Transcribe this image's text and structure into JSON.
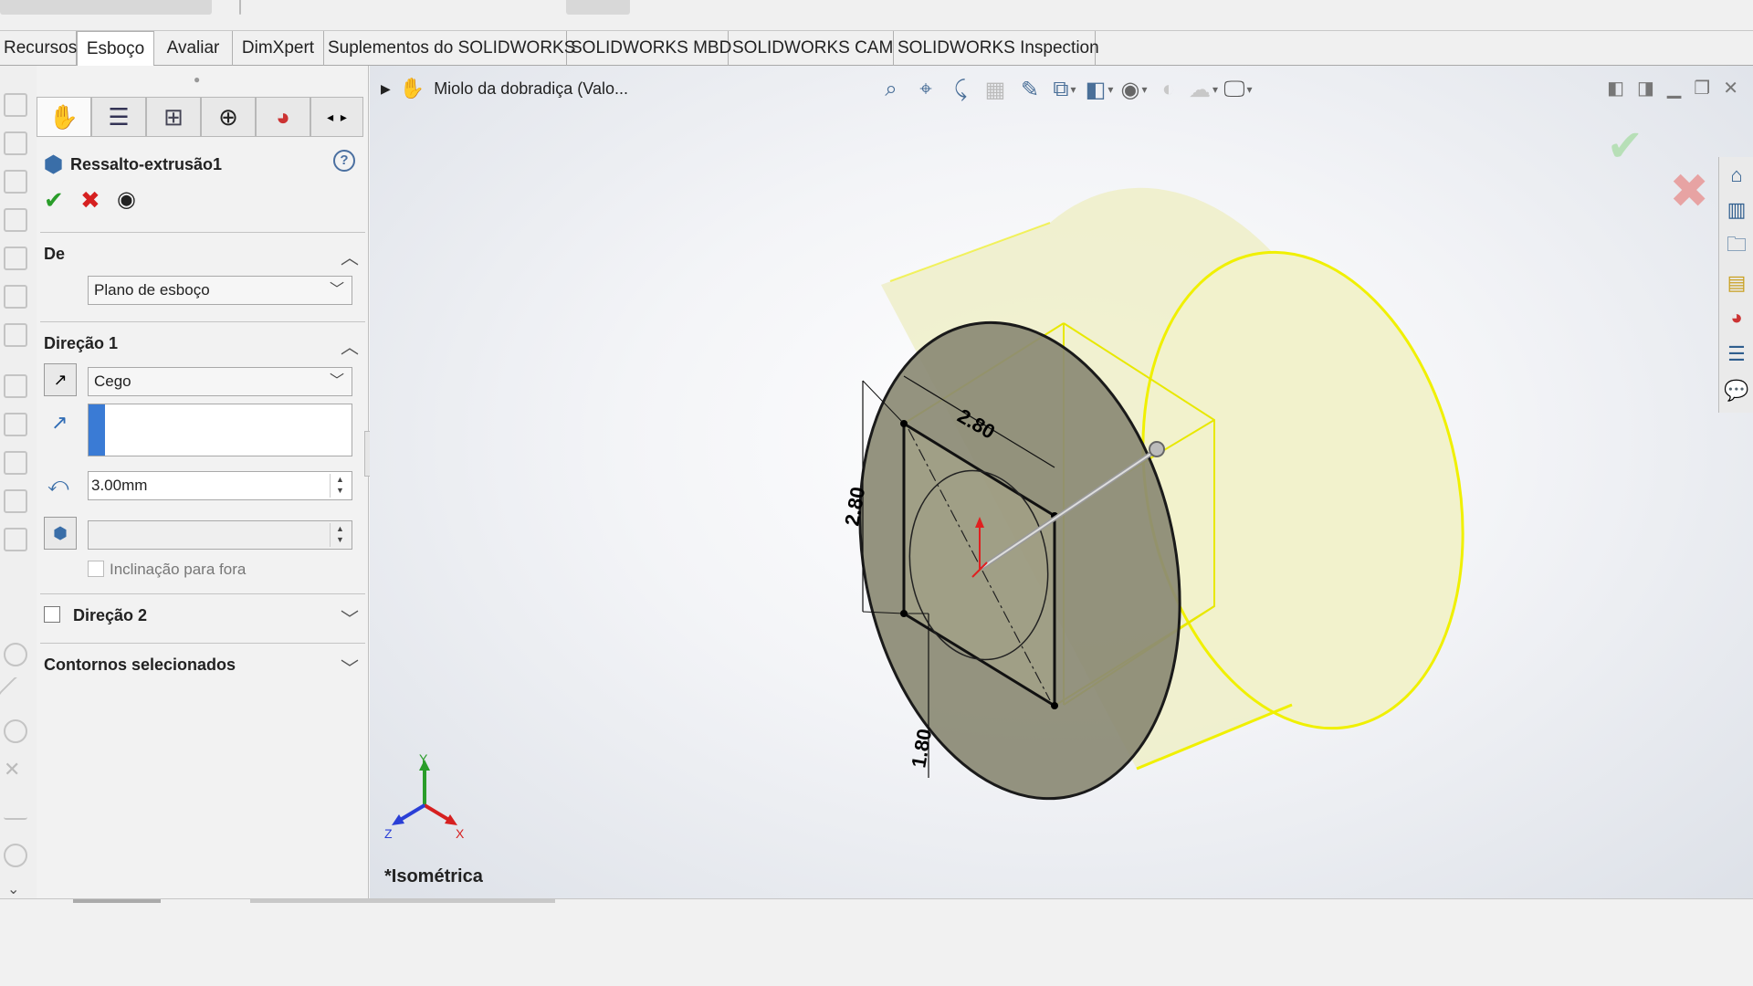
{
  "tabs": [
    {
      "label": "Recursos"
    },
    {
      "label": "Esboço"
    },
    {
      "label": "Avaliar"
    },
    {
      "label": "DimXpert"
    },
    {
      "label": "Suplementos do SOLIDWORKS"
    },
    {
      "label": "SOLIDWORKS MBD"
    },
    {
      "label": "SOLIDWORKS CAM"
    },
    {
      "label": "SOLIDWORKS Inspection"
    }
  ],
  "active_tab": "Esboço",
  "property_manager": {
    "title": "Ressalto-extrusão1",
    "help_icon": "help-icon",
    "de": {
      "label": "De",
      "value": "Plano de esboço"
    },
    "direcao1": {
      "label": "Direção 1",
      "end_condition": "Cego",
      "direction_field": "",
      "depth": "3.00mm",
      "draft_value": "",
      "draft_label": "Inclinação para fora"
    },
    "direcao2": {
      "label": "Direção 2"
    },
    "contornos": {
      "label": "Contornos selecionados"
    }
  },
  "graphics": {
    "feature_tree_item": "Miolo da dobradiça  (Valo...",
    "view_label": "*Isométrica",
    "dimensions": [
      "2.80",
      "2.80",
      "1.80"
    ],
    "axes": {
      "x": "X",
      "y": "Y",
      "z": "Z"
    }
  },
  "colors": {
    "accent_blue": "#3a7bd5",
    "ok_green": "#2a9d2a",
    "cancel_red": "#d62020",
    "extrusion_yellow": "#f5f5c8",
    "sketch_face": "#8b8a74"
  }
}
